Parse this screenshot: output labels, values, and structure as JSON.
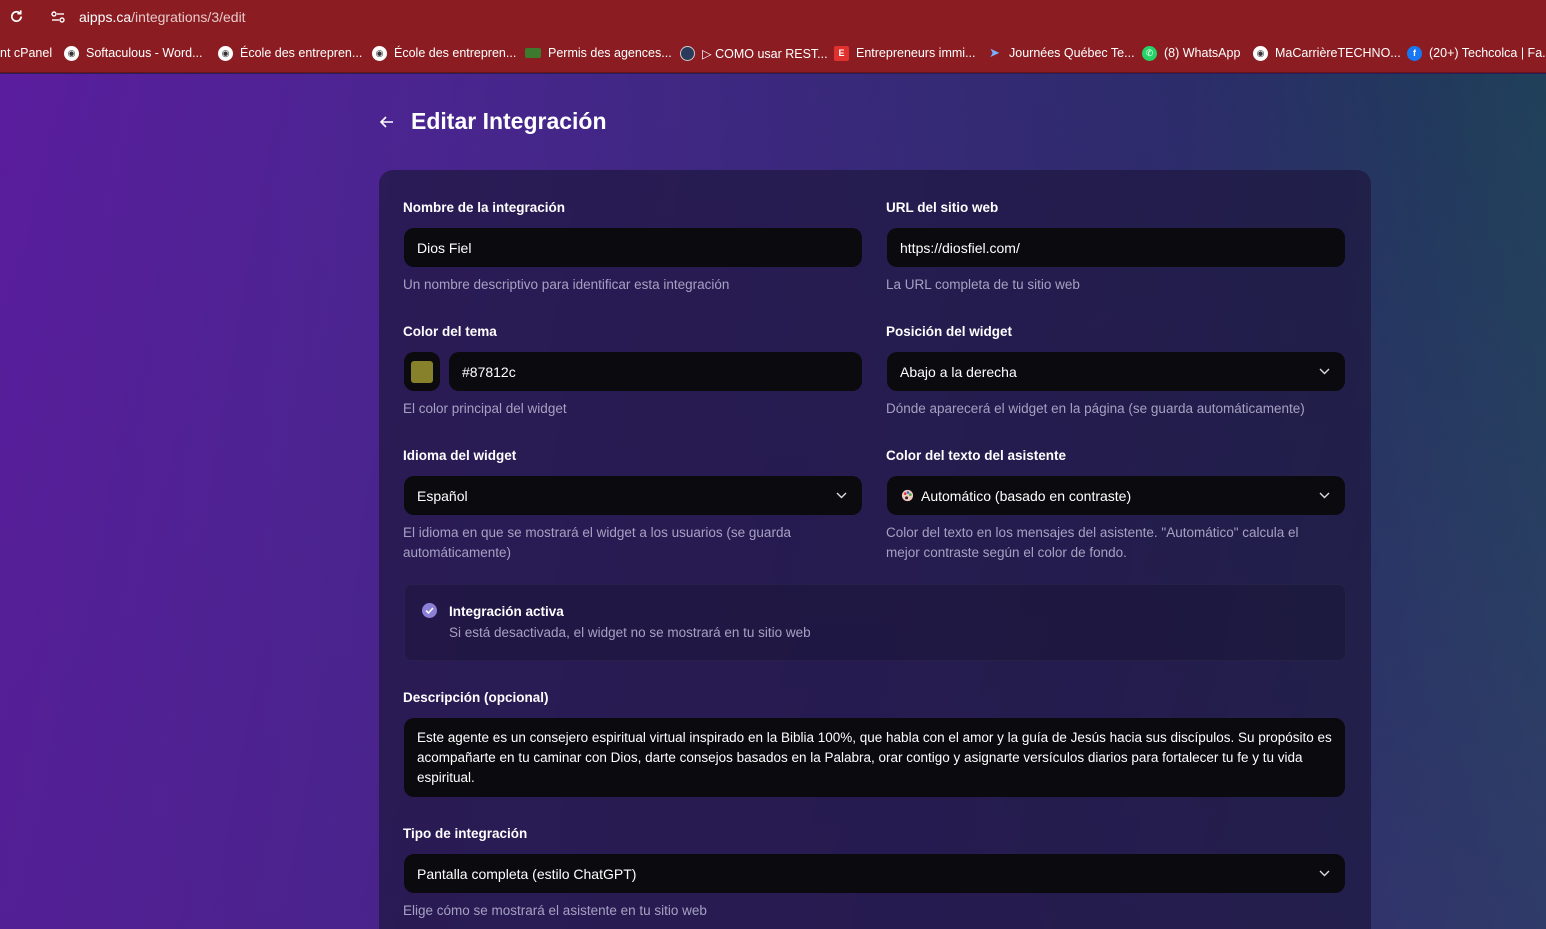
{
  "browser": {
    "url_domain": "aipps.ca",
    "url_path": "/integrations/3/edit",
    "bookmarks": [
      {
        "label": "nt cPanel",
        "icon": "none"
      },
      {
        "label": "Softaculous - Word...",
        "icon": "globe-icon"
      },
      {
        "label": "École des entrepren...",
        "icon": "globe-icon"
      },
      {
        "label": "École des entrepren...",
        "icon": "globe-icon"
      },
      {
        "label": "Permis des agences...",
        "icon": "flag-icon"
      },
      {
        "label": "▷ COMO usar REST...",
        "icon": "badge-icon"
      },
      {
        "label": "Entrepreneurs immi...",
        "icon": "e-logo-icon"
      },
      {
        "label": "Journées Québec Te...",
        "icon": "arrow-logo-icon"
      },
      {
        "label": "(8) WhatsApp",
        "icon": "whatsapp-icon"
      },
      {
        "label": "MaCarrièreTECHNO...",
        "icon": "globe-icon"
      },
      {
        "label": "(20+) Techcolca | Fa...",
        "icon": "facebook-icon"
      }
    ]
  },
  "header": {
    "title": "Editar Integración"
  },
  "form": {
    "name": {
      "label": "Nombre de la integración",
      "value": "Dios Fiel",
      "help": "Un nombre descriptivo para identificar esta integración"
    },
    "url": {
      "label": "URL del sitio web",
      "value": "https://diosfiel.com/",
      "help": "La URL completa de tu sitio web"
    },
    "theme_color": {
      "label": "Color del tema",
      "value": "#87812c",
      "help": "El color principal del widget"
    },
    "position": {
      "label": "Posición del widget",
      "value": "Abajo a la derecha",
      "help": "Dónde aparecerá el widget en la página (se guarda automáticamente)"
    },
    "language": {
      "label": "Idioma del widget",
      "value": "Español",
      "help": "El idioma en que se mostrará el widget a los usuarios (se guarda automáticamente)"
    },
    "text_color": {
      "label": "Color del texto del asistente",
      "value": "Automático (basado en contraste)",
      "help": "Color del texto en los mensajes del asistente. \"Automático\" calcula el mejor contraste según el color de fondo."
    },
    "active": {
      "title": "Integración activa",
      "help": "Si está desactivada, el widget no se mostrará en tu sitio web",
      "checked": true
    },
    "description": {
      "label": "Descripción (opcional)",
      "value": "Este agente es un consejero espiritual virtual inspirado en la Biblia 100%, que habla con el amor y la guía de Jesús hacia sus discípulos. Su propósito es acompañarte en tu caminar con Dios, darte consejos basados en la Palabra, orar contigo y asignarte versículos diarios para fortalecer tu fe y tu vida espiritual."
    },
    "type": {
      "label": "Tipo de integración",
      "value": "Pantalla completa (estilo ChatGPT)",
      "help": "Elige cómo se mostrará el asistente en tu sitio web"
    }
  },
  "colors": {
    "chrome": "#8b1d22",
    "checkbox": "#8b7fd6",
    "field_bg": "#0b0a0e"
  }
}
